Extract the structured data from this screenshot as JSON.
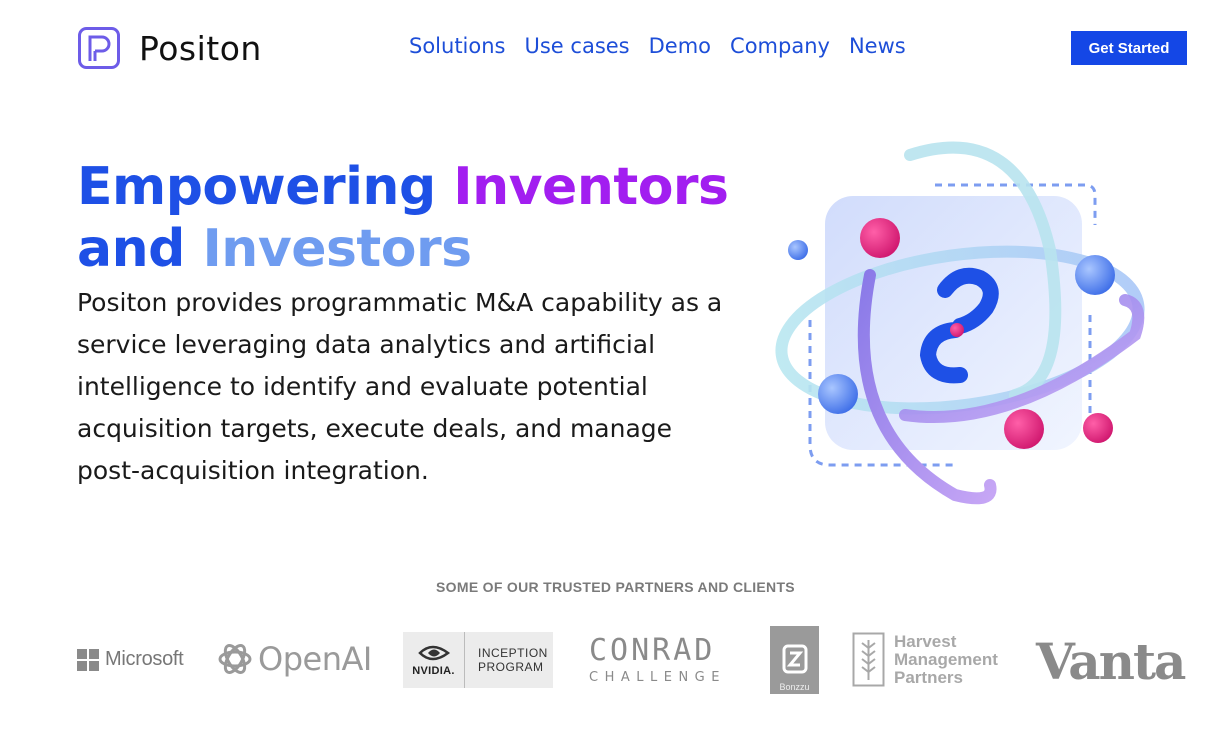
{
  "brand": {
    "name": "Positon"
  },
  "nav": {
    "items": [
      "Solutions",
      "Use cases",
      "Demo",
      "Company",
      "News"
    ]
  },
  "header": {
    "cta_label": "Get Started"
  },
  "hero": {
    "headline_part1": "Empowering",
    "headline_part2": "Inventors",
    "headline_part3": "and",
    "headline_part4": "Investors",
    "body": "Positon provides programmatic M&A capability as a service leveraging data analytics and artificial intelligence to identify and evaluate potential acquisition targets, execute deals, and manage post-acquisition integration."
  },
  "colors": {
    "accent_blue": "#1e50e6",
    "accent_purple": "#a21ef0",
    "accent_light_blue": "#6f9cf0",
    "cta_background": "#1447e6"
  },
  "partners": {
    "title": "SOME OF OUR TRUSTED PARTNERS AND CLIENTS",
    "microsoft": "Microsoft",
    "openai": "OpenAI",
    "nvidia_word": "NVIDIA.",
    "nvidia_line1": "INCEPTION",
    "nvidia_line2": "PROGRAM",
    "conrad_top": "CONRAD",
    "conrad_bottom": "CHALLENGE",
    "bonzzu": "Bonzzu",
    "harvest_line1": "Harvest",
    "harvest_line2": "Management",
    "harvest_line3": "Partners",
    "vanta": "Vanta"
  }
}
